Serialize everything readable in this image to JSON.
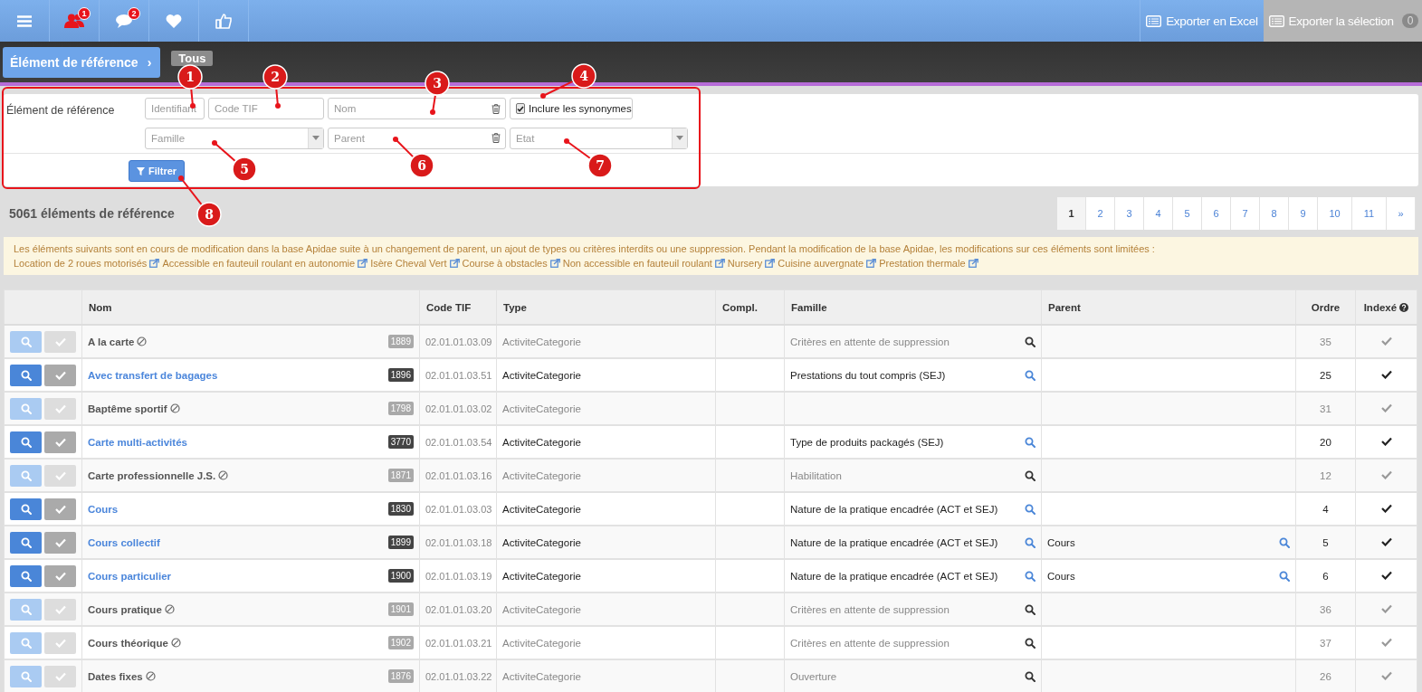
{
  "topbar": {
    "badges": [
      "1",
      "2"
    ],
    "export_excel": "Exporter en Excel",
    "export_selection": "Exporter la sélection",
    "selection_count": "0"
  },
  "breadcrumb": {
    "title": "Élément de référence",
    "chevron": "›",
    "tag": "Tous"
  },
  "filters": {
    "label": "Élément de référence",
    "identifiant": {
      "placeholder": "Identifiant"
    },
    "code_tif": {
      "placeholder": "Code TIF"
    },
    "nom": {
      "placeholder": "Nom"
    },
    "synonymes": {
      "label": "Inclure les synonymes",
      "checked": true
    },
    "famille": {
      "placeholder": "Famille"
    },
    "parent": {
      "placeholder": "Parent"
    },
    "etat": {
      "placeholder": "Etat"
    },
    "button": "Filtrer"
  },
  "callouts": [
    "1",
    "2",
    "3",
    "4",
    "5",
    "6",
    "7",
    "8"
  ],
  "count": "5061 éléments de référence",
  "pagination": [
    {
      "label": "1",
      "selected": true
    },
    {
      "label": "2",
      "selected": false
    },
    {
      "label": "3",
      "selected": false
    },
    {
      "label": "4",
      "selected": false
    },
    {
      "label": "5",
      "selected": false
    },
    {
      "label": "6",
      "selected": false
    },
    {
      "label": "7",
      "selected": false
    },
    {
      "label": "8",
      "selected": false
    },
    {
      "label": "9",
      "selected": false
    },
    {
      "label": "10",
      "selected": false
    },
    {
      "label": "11",
      "selected": false
    },
    {
      "label": "»",
      "selected": false
    }
  ],
  "notice": {
    "text": "Les éléments suivants sont en cours de modification dans la base Apidae suite à un changement de parent, un ajout de types ou critères interdits ou une suppression. Pendant la modification de la base Apidae, les modifications sur ces éléments sont limitées :",
    "links": [
      "Location de 2 roues motorisés",
      "Accessible en fauteuil roulant en autonomie",
      "Isère Cheval Vert",
      "Course à obstacles",
      "Non accessible en fauteuil roulant",
      "Nursery",
      "Cuisine auvergnate",
      "Prestation thermale"
    ]
  },
  "table": {
    "columns": [
      "Nom",
      "Code TIF",
      "Type",
      "Compl.",
      "Famille",
      "Parent",
      "Ordre",
      "Indexé"
    ],
    "rows": [
      {
        "name": "A la carte",
        "active": false,
        "id": "1889",
        "code": "02.01.01.03.09",
        "type": "ActiviteCategorie",
        "famille": "Critères en attente de suppression",
        "parent": "",
        "ordre": "35"
      },
      {
        "name": "Avec transfert de bagages",
        "active": true,
        "id": "1896",
        "code": "02.01.01.03.51",
        "type": "ActiviteCategorie",
        "famille": "Prestations du tout compris (SEJ)",
        "parent": "",
        "ordre": "25"
      },
      {
        "name": "Baptême sportif",
        "active": false,
        "id": "1798",
        "code": "02.01.01.03.02",
        "type": "ActiviteCategorie",
        "famille": "",
        "parent": "",
        "ordre": "31"
      },
      {
        "name": "Carte multi-activités",
        "active": true,
        "id": "3770",
        "code": "02.01.01.03.54",
        "type": "ActiviteCategorie",
        "famille": "Type de produits packagés (SEJ)",
        "parent": "",
        "ordre": "20"
      },
      {
        "name": "Carte professionnelle J.S.",
        "active": false,
        "id": "1871",
        "code": "02.01.01.03.16",
        "type": "ActiviteCategorie",
        "famille": "Habilitation",
        "parent": "",
        "ordre": "12"
      },
      {
        "name": "Cours",
        "active": true,
        "id": "1830",
        "code": "02.01.01.03.03",
        "type": "ActiviteCategorie",
        "famille": "Nature de la pratique encadrée (ACT et SEJ)",
        "parent": "",
        "ordre": "4"
      },
      {
        "name": "Cours collectif",
        "active": true,
        "id": "1899",
        "code": "02.01.01.03.18",
        "type": "ActiviteCategorie",
        "famille": "Nature de la pratique encadrée (ACT et SEJ)",
        "parent": "Cours",
        "ordre": "5"
      },
      {
        "name": "Cours particulier",
        "active": true,
        "id": "1900",
        "code": "02.01.01.03.19",
        "type": "ActiviteCategorie",
        "famille": "Nature de la pratique encadrée (ACT et SEJ)",
        "parent": "Cours",
        "ordre": "6"
      },
      {
        "name": "Cours pratique",
        "active": false,
        "id": "1901",
        "code": "02.01.01.03.20",
        "type": "ActiviteCategorie",
        "famille": "Critères en attente de suppression",
        "parent": "",
        "ordre": "36"
      },
      {
        "name": "Cours théorique",
        "active": false,
        "id": "1902",
        "code": "02.01.01.03.21",
        "type": "ActiviteCategorie",
        "famille": "Critères en attente de suppression",
        "parent": "",
        "ordre": "37"
      },
      {
        "name": "Dates fixes",
        "active": false,
        "id": "1876",
        "code": "02.01.01.03.22",
        "type": "ActiviteCategorie",
        "famille": "Ouverture",
        "parent": "",
        "ordre": "26"
      }
    ]
  }
}
